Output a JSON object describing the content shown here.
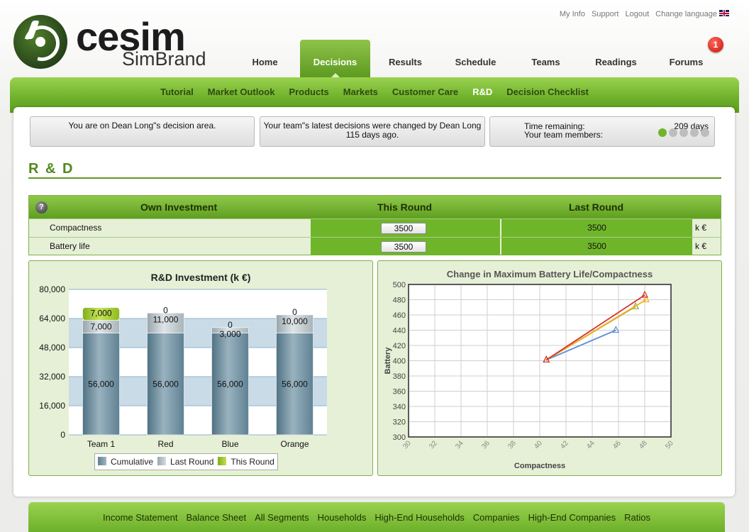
{
  "logo": {
    "word": "cesim",
    "sub": "SimBrand"
  },
  "top_links": [
    "My Info",
    "Support",
    "Logout",
    "Change language"
  ],
  "main_nav": [
    {
      "label": "Home",
      "active": false
    },
    {
      "label": "Decisions",
      "active": true
    },
    {
      "label": "Results",
      "active": false
    },
    {
      "label": "Schedule",
      "active": false
    },
    {
      "label": "Teams",
      "active": false
    },
    {
      "label": "Readings",
      "active": false
    },
    {
      "label": "Forums",
      "active": false
    }
  ],
  "forum_badge": "1",
  "sub_nav": [
    {
      "label": "Tutorial",
      "active": false
    },
    {
      "label": "Market Outlook",
      "active": false
    },
    {
      "label": "Products",
      "active": false
    },
    {
      "label": "Markets",
      "active": false
    },
    {
      "label": "Customer Care",
      "active": false
    },
    {
      "label": "R&D",
      "active": true
    },
    {
      "label": "Decision Checklist",
      "active": false
    }
  ],
  "info": {
    "area": "You are on Dean Long\"s decision area.",
    "changed_line1": "Your team\"s latest decisions were changed by Dean Long",
    "changed_line2": "115 days ago.",
    "time_label": "Time remaining:",
    "time_value": "209 days",
    "members_label": "Your team members:",
    "members": [
      true,
      false,
      false,
      false,
      false
    ]
  },
  "page_title": "R & D",
  "table": {
    "headers": {
      "own": "Own Investment",
      "this": "This Round",
      "last": "Last Round"
    },
    "rows": [
      {
        "label": "Compactness",
        "this_round": "3500",
        "last_round": "3500",
        "unit": "k €"
      },
      {
        "label": "Battery life",
        "this_round": "3500",
        "last_round": "3500",
        "unit": "k €"
      }
    ]
  },
  "chart_data": [
    {
      "type": "bar",
      "title": "R&D Investment (k €)",
      "categories": [
        "Team 1",
        "Red",
        "Blue",
        "Orange"
      ],
      "series": [
        {
          "name": "Cumulative",
          "values": [
            56000,
            56000,
            56000,
            56000
          ],
          "color": "#6a8ea0"
        },
        {
          "name": "Last Round",
          "values": [
            7000,
            11000,
            3000,
            10000
          ],
          "color": "#b9c6cc"
        },
        {
          "name": "This Round",
          "values": [
            7000,
            0,
            0,
            0
          ],
          "color": "#a8cf2a"
        }
      ],
      "labels": {
        "cumulative": [
          "56,000",
          "56,000",
          "56,000",
          "56,000"
        ],
        "last_round": [
          "7,000",
          "11,000",
          "3,000",
          "10,000"
        ],
        "this_round": [
          "7,000",
          "0",
          "0",
          "0"
        ]
      },
      "yticks": [
        "0",
        "16,000",
        "32,000",
        "48,000",
        "64,000",
        "80,000"
      ],
      "ylim": [
        0,
        80000
      ],
      "legend": "bottom"
    },
    {
      "type": "line",
      "title": "Change in Maximum Battery Life/Compactness",
      "xlabel": "Compactness",
      "ylabel": "Battery",
      "xlim": [
        30,
        50
      ],
      "ylim": [
        300,
        500
      ],
      "xticks": [
        "30",
        "32",
        "34",
        "36",
        "38",
        "40",
        "42",
        "44",
        "46",
        "48",
        "50"
      ],
      "yticks": [
        "300",
        "320",
        "340",
        "360",
        "380",
        "400",
        "420",
        "440",
        "460",
        "480",
        "500"
      ],
      "series": [
        {
          "x": [
            40.5,
            45.8
          ],
          "y": [
            401,
            440
          ],
          "color": "#5a8fd8"
        },
        {
          "x": [
            40.5,
            47.3
          ],
          "y": [
            401,
            471
          ],
          "color": "#8fb030"
        },
        {
          "x": [
            40.5,
            48.1
          ],
          "y": [
            401,
            480
          ],
          "color": "#f0b020"
        },
        {
          "x": [
            40.5,
            48.0
          ],
          "y": [
            401,
            486
          ],
          "color": "#d83030"
        }
      ],
      "grid": true
    }
  ],
  "footer_nav": [
    "Income Statement",
    "Balance Sheet",
    "All Segments",
    "Households",
    "High-End Households",
    "Companies",
    "High-End Companies",
    "Ratios"
  ]
}
